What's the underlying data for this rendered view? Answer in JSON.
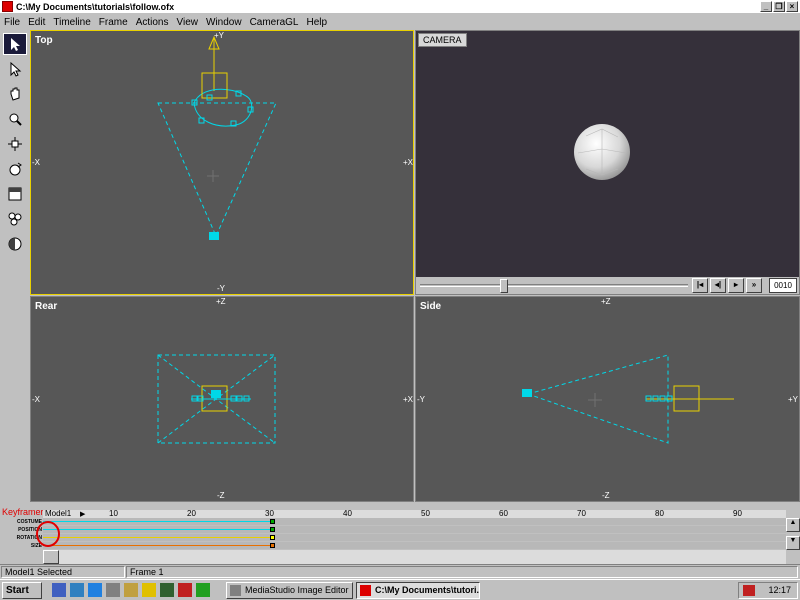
{
  "window": {
    "title": "C:\\My Documents\\tutorials\\follow.ofx"
  },
  "menu": [
    "File",
    "Edit",
    "Timeline",
    "Frame",
    "Actions",
    "View",
    "Window",
    "CameraGL",
    "Help"
  ],
  "toolbar": {
    "tools": [
      "select-icon",
      "move-icon",
      "hand-icon",
      "zoom-icon",
      "dolly-icon",
      "rotate-icon",
      "box-icon",
      "spheres-icon",
      "shade-icon"
    ]
  },
  "viewports": {
    "top": {
      "label": "Top",
      "axis_top": "+Y",
      "axis_bottom": "-Y",
      "axis_left": "-X",
      "axis_right": "+X"
    },
    "camera": {
      "label": "CAMERA",
      "frame": "0010"
    },
    "rear": {
      "label": "Rear",
      "axis_top": "+Z",
      "axis_bottom": "-Z",
      "axis_left": "-X",
      "axis_right": "+X"
    },
    "side": {
      "label": "Side",
      "axis_top": "+Z",
      "axis_bottom": "-Z",
      "axis_left": "-Y",
      "axis_right": "+Y"
    }
  },
  "keyframer": {
    "title": "Keyframer",
    "model": "Model1",
    "ruler_ticks": [
      "10",
      "20",
      "30",
      "40",
      "50",
      "60",
      "70",
      "80",
      "90"
    ],
    "rows": [
      "COSTUME",
      "POSITION",
      "ROTATION",
      "SIZE"
    ]
  },
  "status": {
    "selection": "Model1 Selected",
    "frame": "Frame 1"
  },
  "taskbar": {
    "start": "Start",
    "tasks": [
      "MediaStudio Image Editor",
      "C:\\My Documents\\tutori..."
    ],
    "clock": "12:17"
  },
  "colors": {
    "viewport_bg": "#575757",
    "wire": "#00d8e8",
    "active_border": "#e8d000",
    "camera_bg": "#35303a"
  }
}
